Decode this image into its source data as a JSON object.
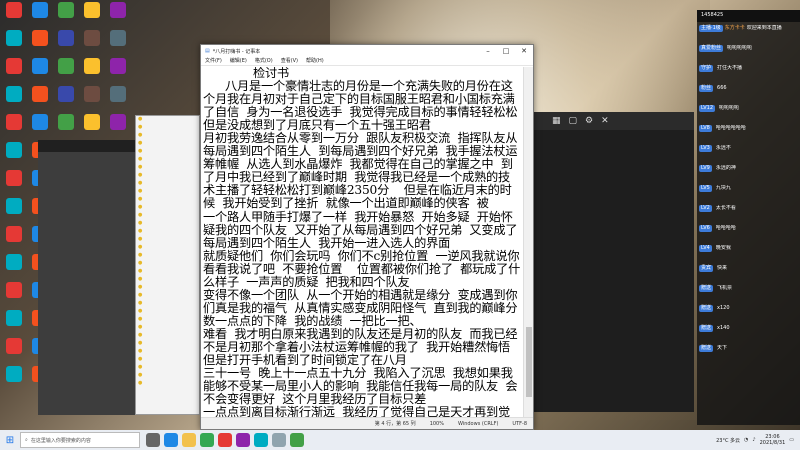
{
  "notepad": {
    "title": "*八月打嗨书 - 记事本",
    "menu": [
      "文件(F)",
      "编辑(E)",
      "格式(O)",
      "查看(V)",
      "帮助(H)"
    ],
    "heading": "检讨书",
    "paragraphs": [
      "      八月是一个豪情壮志的月份是一个充满失败的月份在这个月我在月初对于自己定下的目标国服王昭君和小国标充满了自信  身为一名退役选手  我觉得完成目标的事情轻轻松松  但是没成想到了月底只有一个五十强王昭君",
      "月初我劳逸结合从零到一万分  跟队友积极交流  指挥队友从每局遇到四个陌生人  到每局遇到四个好兄弟  我手握法杖运筹帷幄  从选人到水晶爆炸  我都觉得在自己的掌握之中  到了月中我已经到了巅峰时期  我觉得我已经是一个成熟的技术主播了轻轻松松打到巅峰2350分    但是在临近月末的时候  我开始受到了挫折  就像一个出道即巅峰的侠客  被",
      "一个路人甲随手打爆了一样  我开始暴怒  开始多疑  开始怀疑我的四个队友  又开始了从每局遇到四个好兄弟  又变成了每局遇到四个陌生人  我开始一进入选人的界面",
      "就质疑他们  你们会玩吗  你们不c别抢位置  一逆风我就说你看看我说了吧  不要抢位置    位置都被你们抢了  都玩成了什么样子  一声声的质疑  把我和四个队友",
      "变得不像一个团队  从一个开始的相遇就是缘分  变成遇到你们真是我的福气  从真情实感变成阴阳怪气  直到我的巅峰分数一点点的下降  我的战绩  一把比一把、",
      "难看  我才明白原来我遇到的队友还是月初的队友  而我已经不是月初那个拿着小法杖运筹帷幄的我了  我开始糟然悔悟但是打开手机看到了时间锁定了在八月",
      "三十一号  晚上十一点五十九分  我陷入了沉思  我想如果我能够不受某一局里小人的影响  我能信任我每一局的队友  会不会变得更好  这个月里我经历了目标只差",
      "一点点到离目标渐行渐远  我经历了觉得自己是天才再到觉得自己是个废物    没有完成目标  我深表自责    八月的故事"
    ],
    "status": [
      "第 4 行，第 65 列",
      "100%",
      "Windows (CRLF)",
      "UTF-8"
    ]
  },
  "chat": {
    "header": "1458425",
    "messages": [
      {
        "badge": "主播·1级",
        "user": "东方卡卡",
        "text": "欢迎来到本直播"
      },
      {
        "badge": "真爱粉丝",
        "user": "",
        "text": "呃呃呃呃呃"
      },
      {
        "badge": "守护",
        "user": "",
        "text": "打住大不播"
      },
      {
        "badge": "粉丝",
        "user": "",
        "text": "666"
      },
      {
        "badge": "LV12",
        "user": "",
        "text": "呃呃呃呃"
      },
      {
        "badge": "LV8",
        "user": "",
        "text": "哈哈哈哈哈哈"
      },
      {
        "badge": "LV3",
        "user": "",
        "text": "永远不"
      },
      {
        "badge": "LV9",
        "user": "",
        "text": "永远的神"
      },
      {
        "badge": "LV5",
        "user": "",
        "text": "九块九"
      },
      {
        "badge": "LV2",
        "user": "",
        "text": "太长不看"
      },
      {
        "badge": "LV6",
        "user": "",
        "text": "哈哈哈哈"
      },
      {
        "badge": "LV4",
        "user": "",
        "text": "晚安我"
      },
      {
        "badge": "贵宾",
        "user": "",
        "text": "快来"
      },
      {
        "badge": "赠送",
        "user": "",
        "text": "飞机票"
      },
      {
        "badge": "赠送",
        "user": "",
        "text": "x120"
      },
      {
        "badge": "赠送",
        "user": "",
        "text": "x140"
      },
      {
        "badge": "赠送",
        "user": "",
        "text": "天下"
      }
    ]
  },
  "taskbar": {
    "search_placeholder": "在这里输入你要搜索的内容",
    "time": "23:06",
    "date": "2021/8/31",
    "weather": "23°C 多云"
  },
  "colors": {
    "accent": "#1a73e8",
    "chat_bg": "#141414",
    "notepad_bg": "#ffffff"
  }
}
